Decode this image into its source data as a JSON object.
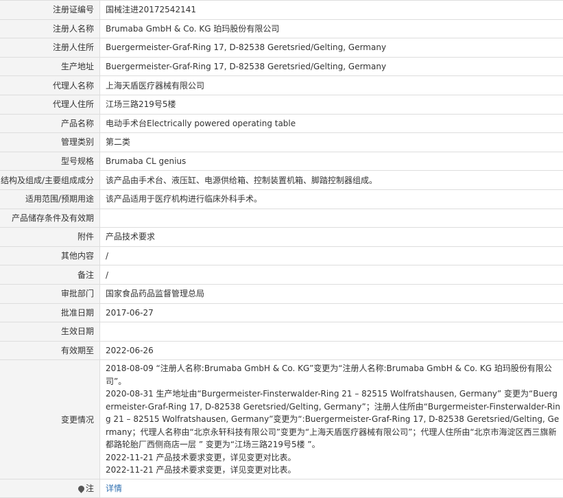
{
  "rows": [
    {
      "label": "注册证编号",
      "value": "国械注进20172542141"
    },
    {
      "label": "注册人名称",
      "value": "Brumaba GmbH & Co. KG 珀玛股份有限公司"
    },
    {
      "label": "注册人住所",
      "value": "Buergermeister-Graf-Ring 17, D-82538 Geretsried/Gelting, Germany"
    },
    {
      "label": "生产地址",
      "value": "Buergermeister-Graf-Ring 17, D-82538 Geretsried/Gelting, Germany"
    },
    {
      "label": "代理人名称",
      "value": "上海天盾医疗器械有限公司"
    },
    {
      "label": "代理人住所",
      "value": "江场三路219号5楼"
    },
    {
      "label": "产品名称",
      "value": "电动手术台Electrically powered operating table"
    },
    {
      "label": "管理类别",
      "value": "第二类"
    },
    {
      "label": "型号规格",
      "value": "Brumaba CL genius"
    },
    {
      "label": "结构及组成/主要组成成分",
      "value": "该产品由手术台、液压缸、电源供给箱、控制装置机箱、脚踏控制器组成。"
    },
    {
      "label": "适用范围/预期用途",
      "value": "该产品适用于医疗机构进行临床外科手术。"
    },
    {
      "label": "产品储存条件及有效期",
      "value": ""
    },
    {
      "label": "附件",
      "value": "产品技术要求"
    },
    {
      "label": "其他内容",
      "value": "/"
    },
    {
      "label": "备注",
      "value": "/"
    },
    {
      "label": "审批部门",
      "value": "国家食品药品监督管理总局"
    },
    {
      "label": "批准日期",
      "value": "2017-06-27"
    },
    {
      "label": "生效日期",
      "value": ""
    },
    {
      "label": "有效期至",
      "value": "2022-06-26"
    }
  ],
  "history": {
    "label": "变更情况",
    "lines": [
      "2018-08-09 “注册人名称:Brumaba GmbH & Co. KG”变更为“注册人名称:Brumaba GmbH & Co. KG 珀玛股份有限公司”。",
      "2020-08-31 生产地址由“Burgermeister-Finsterwalder-Ring 21 – 82515 Wolfratshausen, Germany” 变更为“Buergermeister-Graf-Ring 17, D-82538 Geretsried/Gelting, Germany”；注册人住所由“Burgermeister-Finsterwalder-Ring 21 – 82515 Wolfratshausen, Germany”变更为“:Buergermeister-Graf-Ring 17, D-82538 Geretsried/Gelting, Germany；代理人名称由“北京永轩科技有限公司”变更为“上海天盾医疗器械有限公司”；代理人住所由“北京市海淀区西三旗新都路轮胎厂西侧商店一层 ” 变更为“江场三路219号5楼 ”。",
      "2022-11-21 产品技术要求变更，详见变更对比表。",
      "2022-11-21 产品技术要求变更，详见变更对比表。"
    ]
  },
  "note": {
    "label": "注",
    "icon": "lightbulb-icon",
    "link_text": "详情",
    "link_color": "#2f6fb0"
  }
}
